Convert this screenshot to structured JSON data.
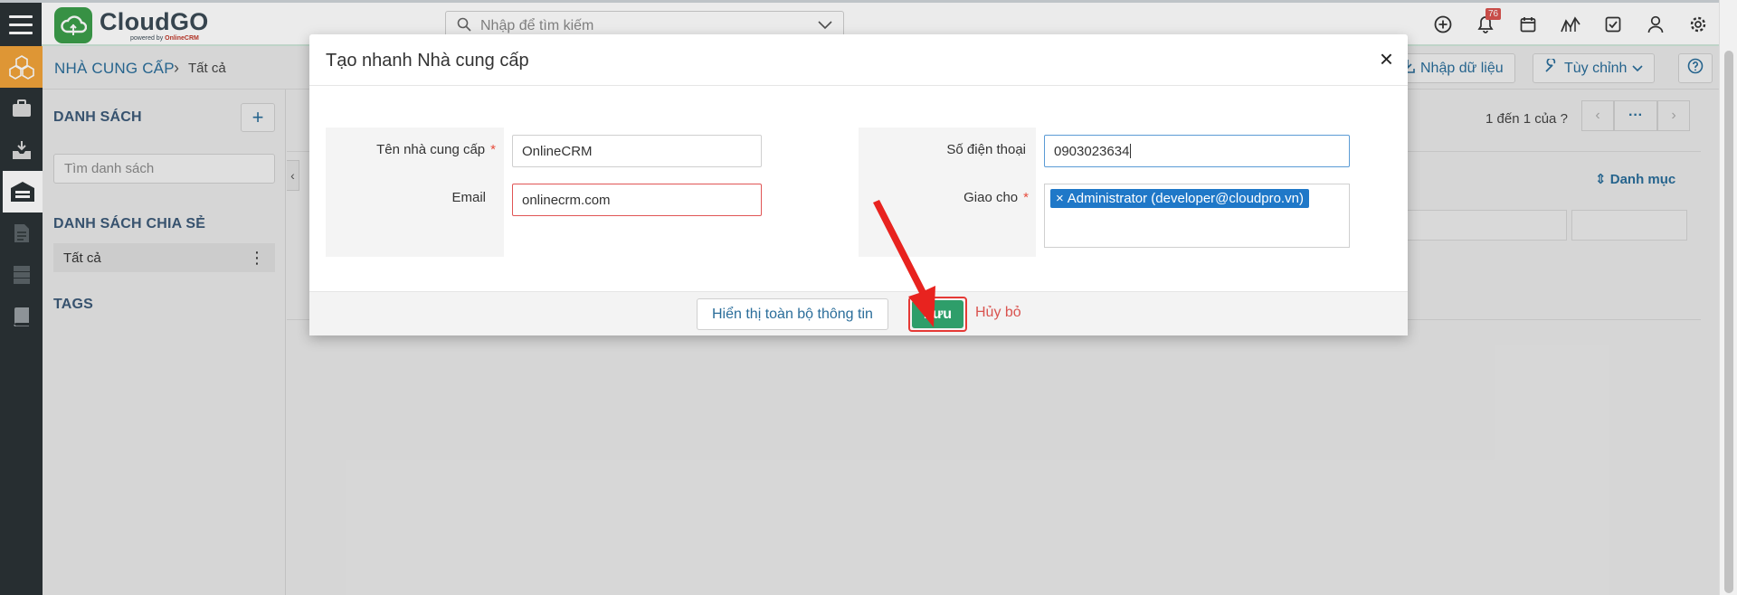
{
  "app": {
    "brand": "CloudGO",
    "brand_sub_prefix": "powered by ",
    "brand_sub_highlight": "OnlineCRM"
  },
  "search": {
    "placeholder": "Nhập để tìm kiếm"
  },
  "notifications": {
    "count": "76"
  },
  "breadcrumb": {
    "module": "NHÀ CUNG CẤP",
    "separator": "›",
    "current": "Tất cả"
  },
  "toolbar": {
    "import_label": "Nhập dữ liệu",
    "customize_label": "Tùy chỉnh"
  },
  "sidebar": {
    "lists_title": "DANH SÁCH",
    "add_symbol": "+",
    "search_placeholder": "Tìm danh sách",
    "shared_title": "DANH SÁCH CHIA SẺ",
    "shared_items": [
      {
        "label": "Tất cả",
        "menu": "⋮"
      }
    ],
    "tags_title": "TAGS"
  },
  "main": {
    "pagination_text": "1 đến 1 của",
    "pagination_help": "?",
    "pager_more": "···",
    "column_header": "Danh mục",
    "collapse_symbol": "‹"
  },
  "modal": {
    "title": "Tạo nhanh Nhà cung cấp",
    "close_symbol": "×",
    "required_mark": "*",
    "fields": {
      "name": {
        "label": "Tên nhà cung cấp",
        "value": "OnlineCRM"
      },
      "email": {
        "label": "Email",
        "value": "onlinecrm.com"
      },
      "phone": {
        "label": "Số điện thoại",
        "value": "0903023634"
      },
      "assigned": {
        "label": "Giao cho",
        "tag_remove": "×",
        "tag_value": "Administrator (developer@cloudpro.vn)"
      }
    },
    "buttons": {
      "show_all": "Hiển thị toàn bộ thông tin",
      "save": "Lưu",
      "cancel": "Hủy bỏ"
    }
  },
  "colors": {
    "sidebar_dark": "#2b3236",
    "home_accent": "#f1a33a",
    "brand_green": "#3c9e4a",
    "link_blue": "#2a6d9a",
    "save_green": "#2e9e6a",
    "highlight_red": "#e53935",
    "tag_blue": "#1f78c8"
  },
  "icons": [
    "menu-icon",
    "cloud-logo-icon",
    "search-icon",
    "chevron-down-icon",
    "plus-circle-icon",
    "bell-icon",
    "calendar-icon",
    "chart-icon",
    "checkbox-icon",
    "user-icon",
    "gear-icon",
    "boxes-icon",
    "briefcase-icon",
    "inbox-icon",
    "warehouse-icon",
    "document-icon",
    "server-icon",
    "book-icon",
    "import-icon",
    "wrench-icon",
    "help-icon",
    "arrow-annotation-icon"
  ]
}
